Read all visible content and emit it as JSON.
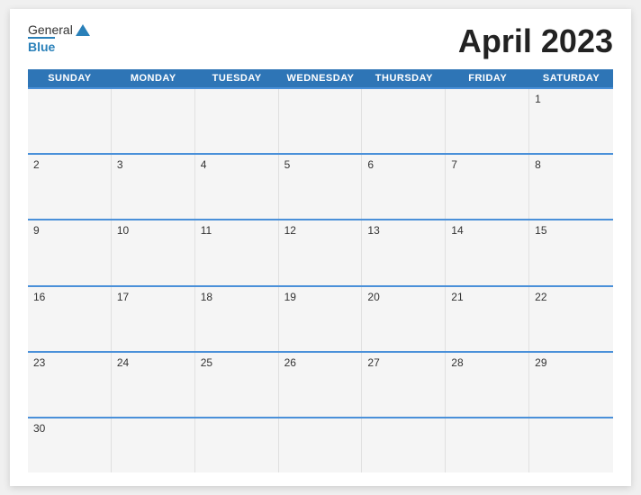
{
  "header": {
    "logo_general": "General",
    "logo_blue": "Blue",
    "month_title": "April 2023"
  },
  "days_of_week": [
    "Sunday",
    "Monday",
    "Tuesday",
    "Wednesday",
    "Thursday",
    "Friday",
    "Saturday"
  ],
  "weeks": [
    [
      {
        "day": "",
        "empty": true
      },
      {
        "day": "",
        "empty": true
      },
      {
        "day": "",
        "empty": true
      },
      {
        "day": "",
        "empty": true
      },
      {
        "day": "",
        "empty": true
      },
      {
        "day": "",
        "empty": true
      },
      {
        "day": "1",
        "empty": false
      }
    ],
    [
      {
        "day": "2",
        "empty": false
      },
      {
        "day": "3",
        "empty": false
      },
      {
        "day": "4",
        "empty": false
      },
      {
        "day": "5",
        "empty": false
      },
      {
        "day": "6",
        "empty": false
      },
      {
        "day": "7",
        "empty": false
      },
      {
        "day": "8",
        "empty": false
      }
    ],
    [
      {
        "day": "9",
        "empty": false
      },
      {
        "day": "10",
        "empty": false
      },
      {
        "day": "11",
        "empty": false
      },
      {
        "day": "12",
        "empty": false
      },
      {
        "day": "13",
        "empty": false
      },
      {
        "day": "14",
        "empty": false
      },
      {
        "day": "15",
        "empty": false
      }
    ],
    [
      {
        "day": "16",
        "empty": false
      },
      {
        "day": "17",
        "empty": false
      },
      {
        "day": "18",
        "empty": false
      },
      {
        "day": "19",
        "empty": false
      },
      {
        "day": "20",
        "empty": false
      },
      {
        "day": "21",
        "empty": false
      },
      {
        "day": "22",
        "empty": false
      }
    ],
    [
      {
        "day": "23",
        "empty": false
      },
      {
        "day": "24",
        "empty": false
      },
      {
        "day": "25",
        "empty": false
      },
      {
        "day": "26",
        "empty": false
      },
      {
        "day": "27",
        "empty": false
      },
      {
        "day": "28",
        "empty": false
      },
      {
        "day": "29",
        "empty": false
      }
    ],
    [
      {
        "day": "30",
        "empty": false
      },
      {
        "day": "",
        "empty": true
      },
      {
        "day": "",
        "empty": true
      },
      {
        "day": "",
        "empty": true
      },
      {
        "day": "",
        "empty": true
      },
      {
        "day": "",
        "empty": true
      },
      {
        "day": "",
        "empty": true
      }
    ]
  ]
}
